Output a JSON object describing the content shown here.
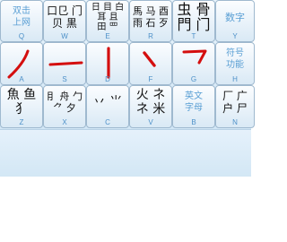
{
  "keys": {
    "q": {
      "text": "双击\n上网",
      "letter": "Q"
    },
    "w": {
      "text": "口㔾 门\n贝 黒",
      "letter": "W"
    },
    "e": {
      "text": "日 目 白\n耳 且\n田 罒",
      "letter": "E"
    },
    "r": {
      "text": "馬 马 酉\n雨 石 歹",
      "letter": "R"
    },
    "t": {
      "text": "虫 骨\n門 门",
      "letter": "T"
    },
    "y": {
      "text": "数字",
      "letter": "Y"
    },
    "a": {
      "text": "",
      "letter": "A"
    },
    "s": {
      "text": "",
      "letter": "S"
    },
    "d": {
      "text": "",
      "letter": "D"
    },
    "f": {
      "text": "",
      "letter": "F"
    },
    "g": {
      "text": "",
      "letter": "G"
    },
    "h": {
      "text": "符号\n功能",
      "letter": "H"
    },
    "z": {
      "text": "魚 鱼\n犭",
      "letter": "Z"
    },
    "x": {
      "text": "⺝ 舟 勹\n⺈ 夕",
      "letter": "X"
    },
    "c": {
      "text": "丷 ⺌",
      "letter": "C"
    },
    "v": {
      "text": "火 ネ\nネ 米",
      "letter": "V"
    },
    "b": {
      "text": "英文\n字母",
      "letter": "B"
    },
    "n": {
      "text": "厂 广\n户 ⼫",
      "letter": "N"
    }
  },
  "colors": {
    "stroke": "#d40f0f",
    "function_text": "#5a9fd4",
    "letter": "#4d90c8"
  },
  "icons": {
    "a": "pie-stroke",
    "s": "horizontal-stroke",
    "d": "vertical-stroke",
    "f": "dot-stroke",
    "g": "turning-stroke"
  }
}
